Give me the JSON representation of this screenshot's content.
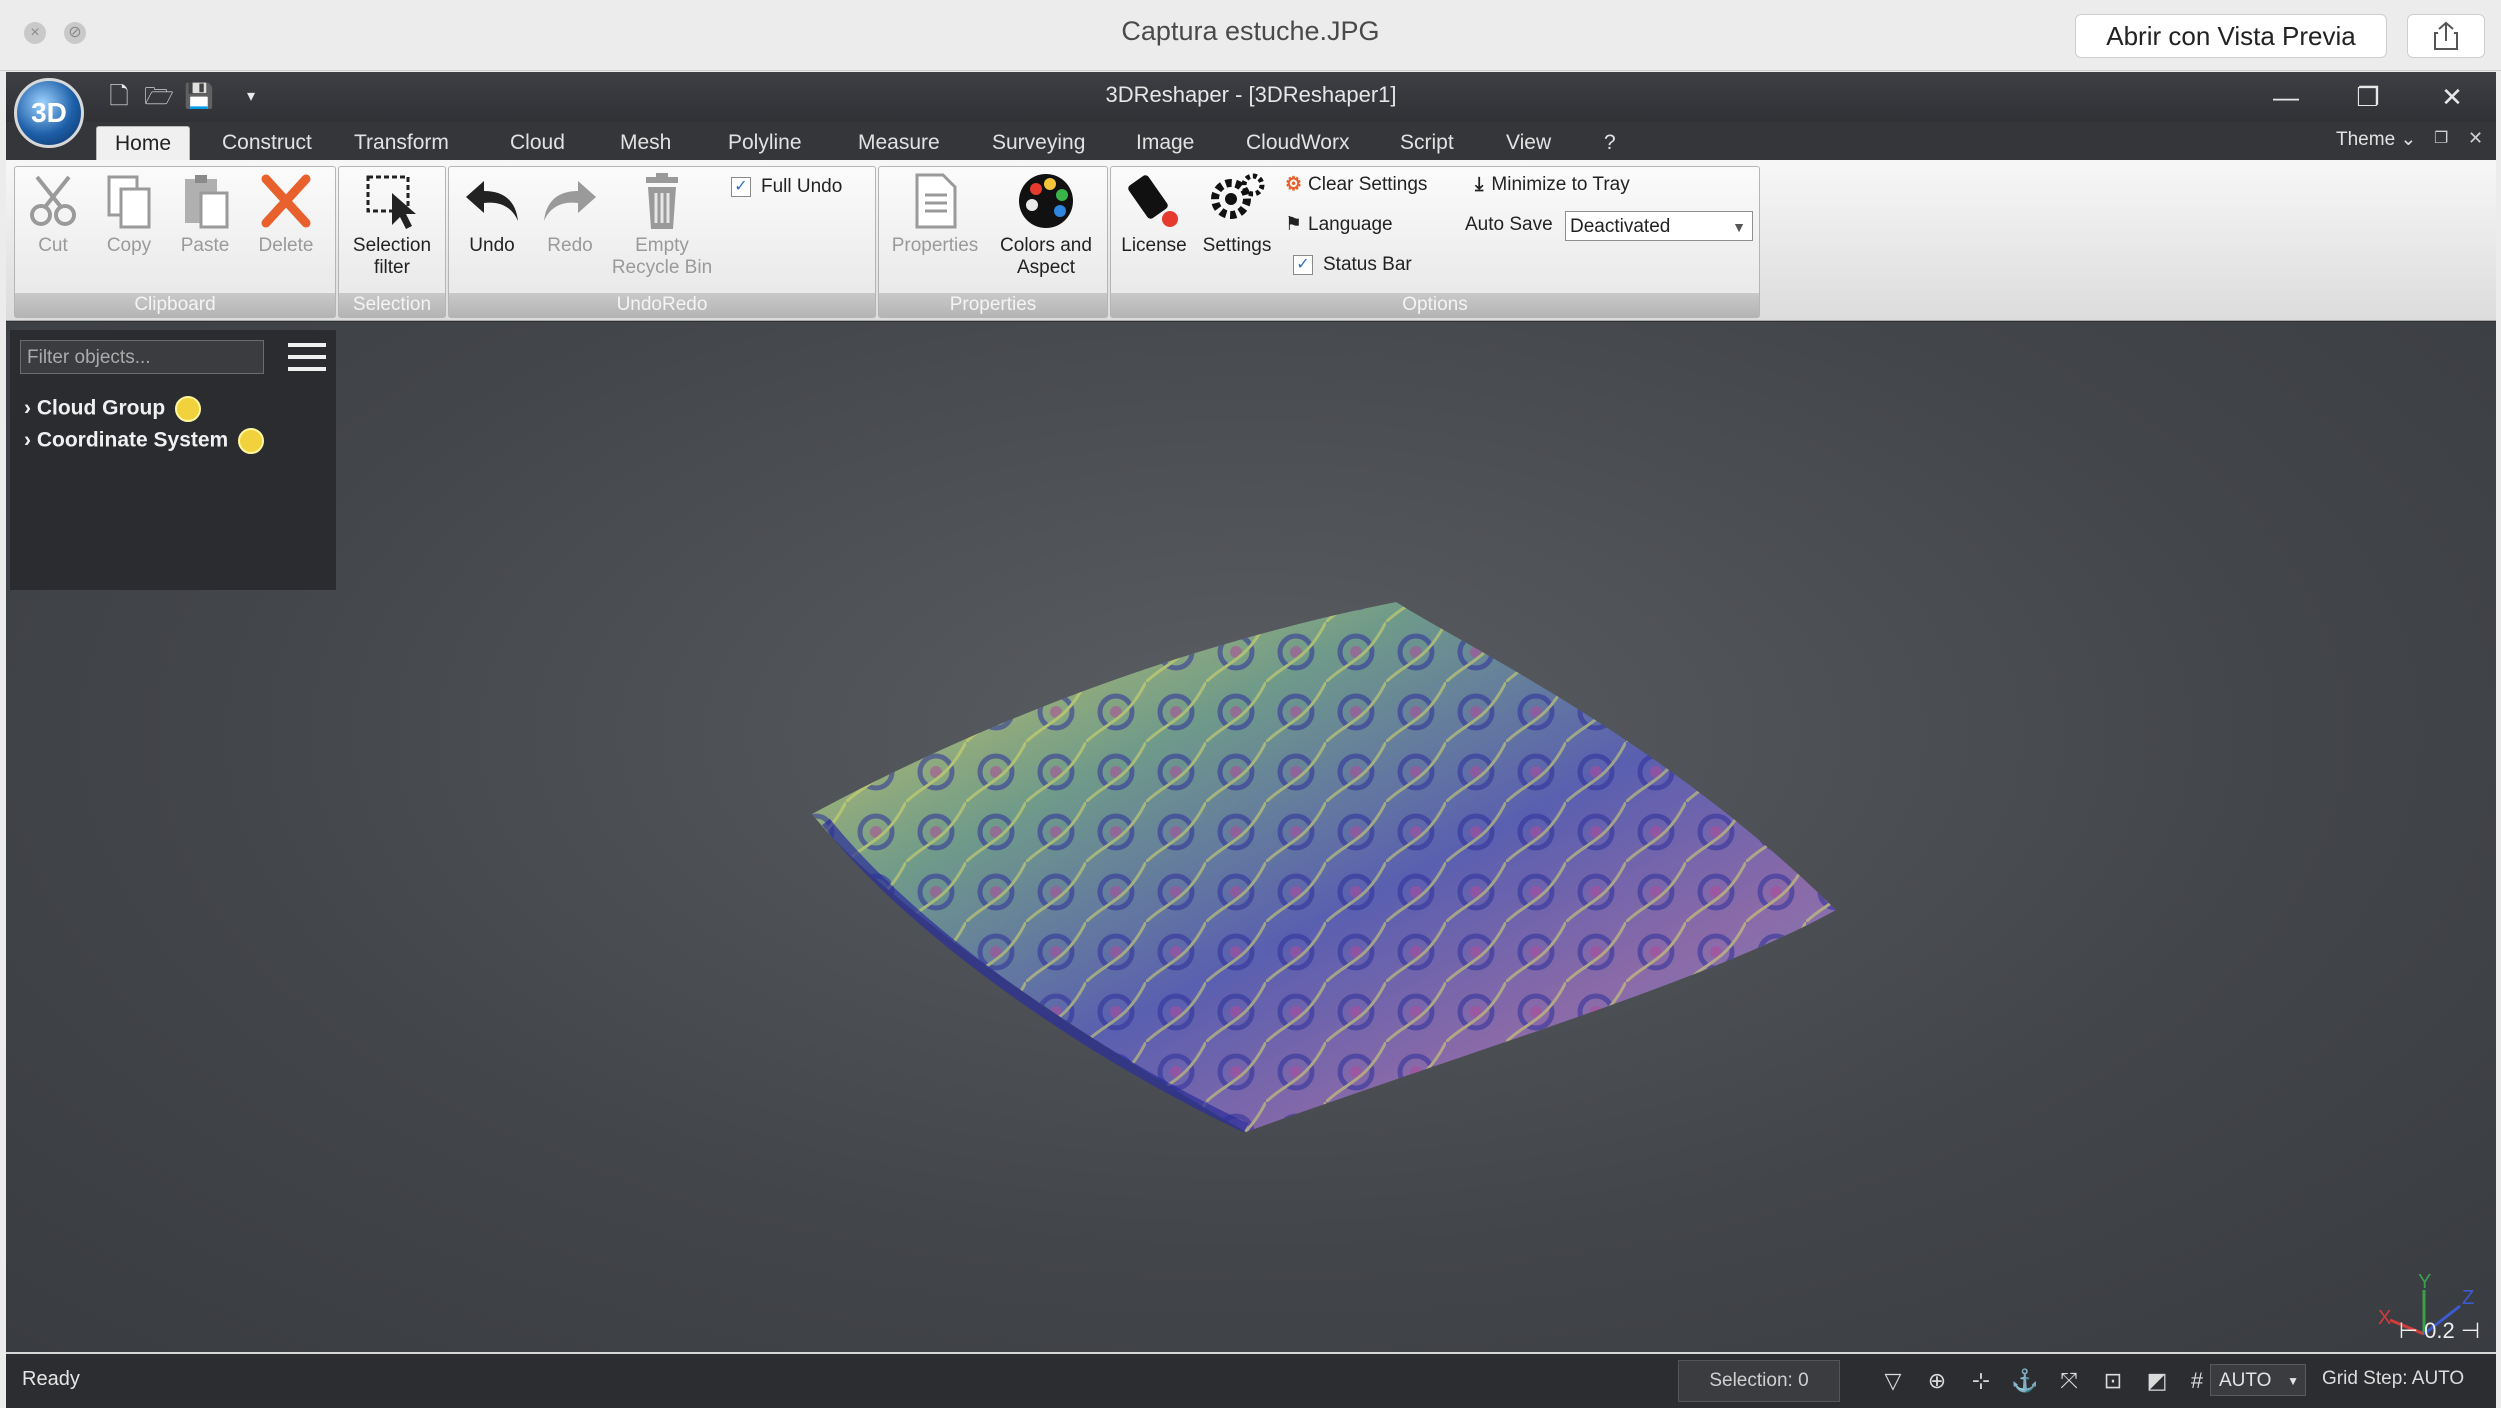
{
  "preview": {
    "title": "Captura estuche.JPG",
    "open_button": "Abrir con Vista Previa"
  },
  "app": {
    "window_title": "3DReshaper - [3DReshaper1]",
    "logo_text": "3D",
    "theme_label": "Theme"
  },
  "tabs": [
    "Home",
    "Construct",
    "Transform",
    "Cloud",
    "Mesh",
    "Polyline",
    "Measure",
    "Surveying",
    "Image",
    "CloudWorx",
    "Script",
    "View",
    "?"
  ],
  "ribbon": {
    "clipboard": {
      "title": "Clipboard",
      "cut": "Cut",
      "copy": "Copy",
      "paste": "Paste",
      "delete": "Delete"
    },
    "selection": {
      "title": "Selection",
      "filter_line1": "Selection",
      "filter_line2": "filter"
    },
    "undoredo": {
      "title": "UndoRedo",
      "undo": "Undo",
      "redo": "Redo",
      "empty_line1": "Empty",
      "empty_line2": "Recycle Bin",
      "full_undo": "Full Undo"
    },
    "properties": {
      "title": "Properties",
      "properties": "Properties",
      "colors_line1": "Colors and",
      "colors_line2": "Aspect"
    },
    "options": {
      "title": "Options",
      "license": "License",
      "settings": "Settings",
      "clear_settings": "Clear Settings",
      "minimize": "Minimize to Tray",
      "language": "Language",
      "auto_save_label": "Auto Save",
      "auto_save_value": "Deactivated",
      "status_bar": "Status Bar"
    }
  },
  "panel": {
    "filter_placeholder": "Filter objects...",
    "tree": [
      {
        "label": "Cloud Group"
      },
      {
        "label": "Coordinate System"
      }
    ]
  },
  "viewport": {
    "scale": "⊢ 0.2 ⊣",
    "axes": {
      "x": "X",
      "y": "Y",
      "z": "Z"
    }
  },
  "statusbar": {
    "status": "Ready",
    "selection": "Selection: 0",
    "auto": "AUTO",
    "grid_step": "Grid Step: AUTO"
  },
  "colors": {
    "accent": "#3470c0",
    "delete_x": "#e8612c",
    "bulb": "#f2d23c"
  }
}
